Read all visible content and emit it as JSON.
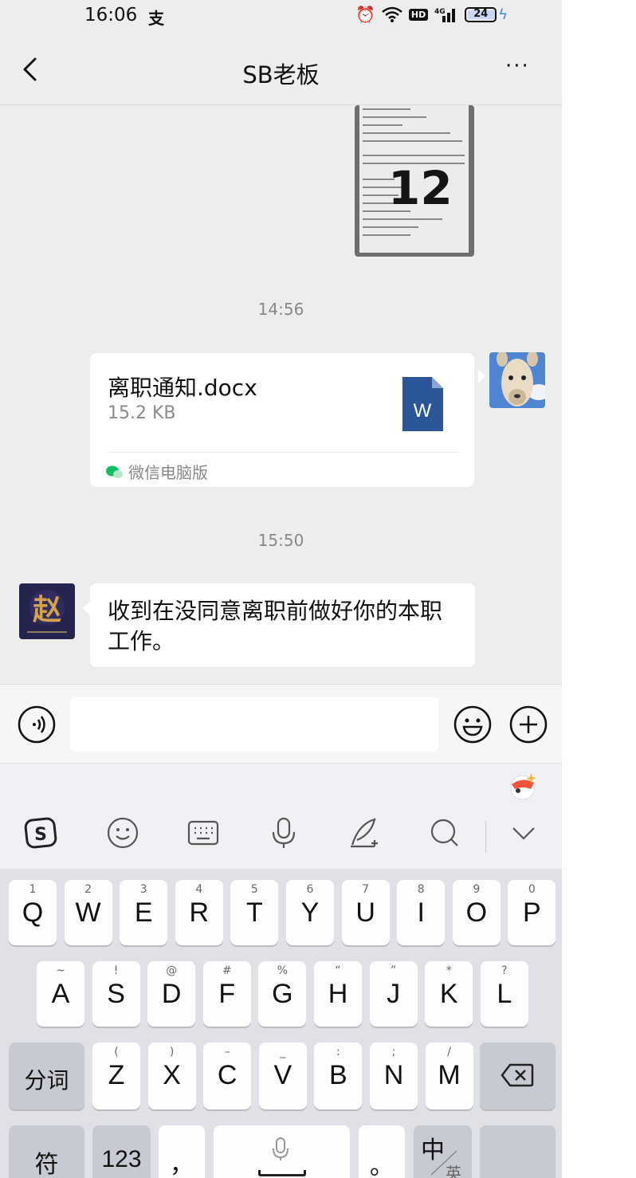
{
  "status_bar": {
    "time": "16:06",
    "app_glyph": "支",
    "battery": "24"
  },
  "nav": {
    "title": "SB老板",
    "more": "···"
  },
  "chat": {
    "timestamps": [
      "14:56",
      "15:50"
    ],
    "file_message": {
      "name": "离职通知.docx",
      "size": "15.2 KB",
      "icon_letter": "W",
      "source": "微信电脑版"
    },
    "text_message": {
      "text": "收到在没同意离职前做好你的本职工作。"
    },
    "receipt_number": "12"
  },
  "keyboard": {
    "row1": [
      {
        "sub": "1",
        "key": "Q"
      },
      {
        "sub": "2",
        "key": "W"
      },
      {
        "sub": "3",
        "key": "E"
      },
      {
        "sub": "4",
        "key": "R"
      },
      {
        "sub": "5",
        "key": "T"
      },
      {
        "sub": "6",
        "key": "Y"
      },
      {
        "sub": "7",
        "key": "U"
      },
      {
        "sub": "8",
        "key": "I"
      },
      {
        "sub": "9",
        "key": "O"
      },
      {
        "sub": "0",
        "key": "P"
      }
    ],
    "row2": [
      {
        "sub": "~",
        "key": "A"
      },
      {
        "sub": "!",
        "key": "S"
      },
      {
        "sub": "@",
        "key": "D"
      },
      {
        "sub": "#",
        "key": "F"
      },
      {
        "sub": "%",
        "key": "G"
      },
      {
        "sub": "“",
        "key": "H"
      },
      {
        "sub": "”",
        "key": "J"
      },
      {
        "sub": "*",
        "key": "K"
      },
      {
        "sub": "?",
        "key": "L"
      }
    ],
    "row3": [
      {
        "sub": "(",
        "key": "Z"
      },
      {
        "sub": ")",
        "key": "X"
      },
      {
        "sub": "–",
        "key": "C"
      },
      {
        "sub": "_",
        "key": "V"
      },
      {
        "sub": ":",
        "key": "B"
      },
      {
        "sub": ";",
        "key": "N"
      },
      {
        "sub": "/",
        "key": "M"
      }
    ],
    "fenci": "分词",
    "fu": "符",
    "num": "123",
    "comma": "，",
    "period": "。",
    "zhong": "中",
    "ying": "英"
  },
  "colors": {
    "background": "#ededed",
    "word_blue": "#2b579a",
    "wechat_green": "#07c160"
  }
}
